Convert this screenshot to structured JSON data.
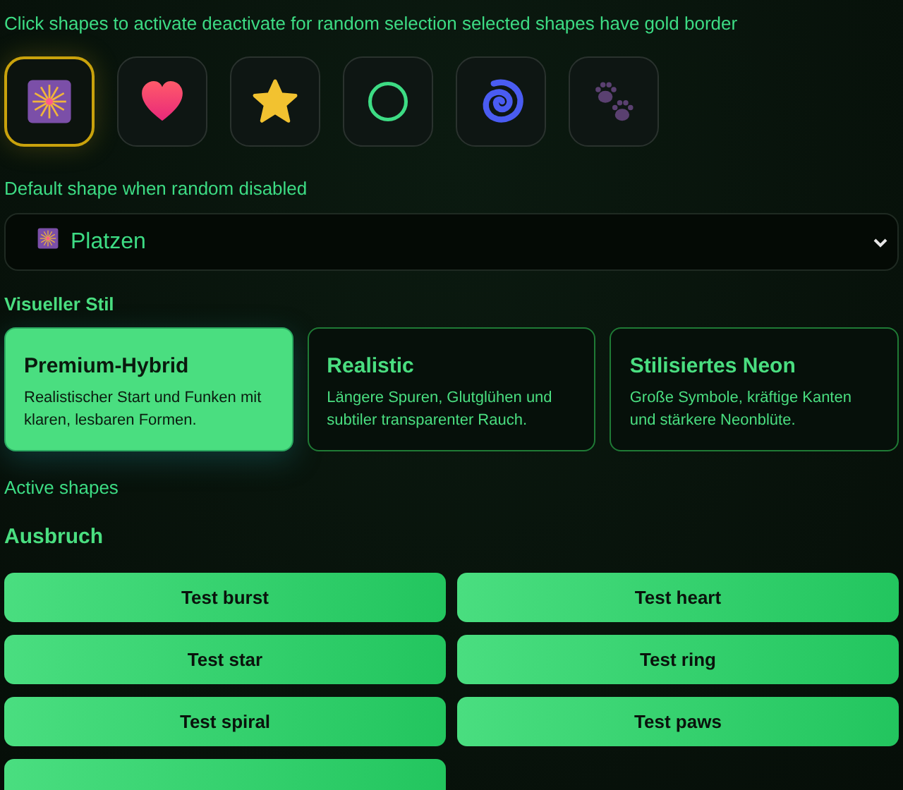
{
  "hint": "Click shapes to activate deactivate for random selection selected shapes have gold border",
  "shapes": [
    {
      "kind": "burst",
      "selected": true
    },
    {
      "kind": "heart",
      "selected": false
    },
    {
      "kind": "star",
      "selected": false
    },
    {
      "kind": "ring",
      "selected": false
    },
    {
      "kind": "spiral",
      "selected": false
    },
    {
      "kind": "paws",
      "selected": false
    }
  ],
  "default_label": "Default shape when random disabled",
  "default_select": {
    "kind": "burst",
    "value": "Platzen"
  },
  "style_heading": "Visueller Stil",
  "styles": [
    {
      "title": "Premium-Hybrid",
      "description": "Realistischer Start und Funken mit klaren, lesbaren Formen.",
      "selected": true
    },
    {
      "title": "Realistic",
      "description": "Längere Spuren, Glutglühen und subtiler transparenter Rauch.",
      "selected": false
    },
    {
      "title": "Stilisiertes Neon",
      "description": "Große Symbole, kräftige Kanten und stärkere Neonblüte.",
      "selected": false
    }
  ],
  "active_label": "Active shapes",
  "group_heading": "Ausbruch",
  "tests": [
    "Test burst",
    "Test heart",
    "Test star",
    "Test ring",
    "Test spiral",
    "Test paws"
  ],
  "more_tests_below": true
}
